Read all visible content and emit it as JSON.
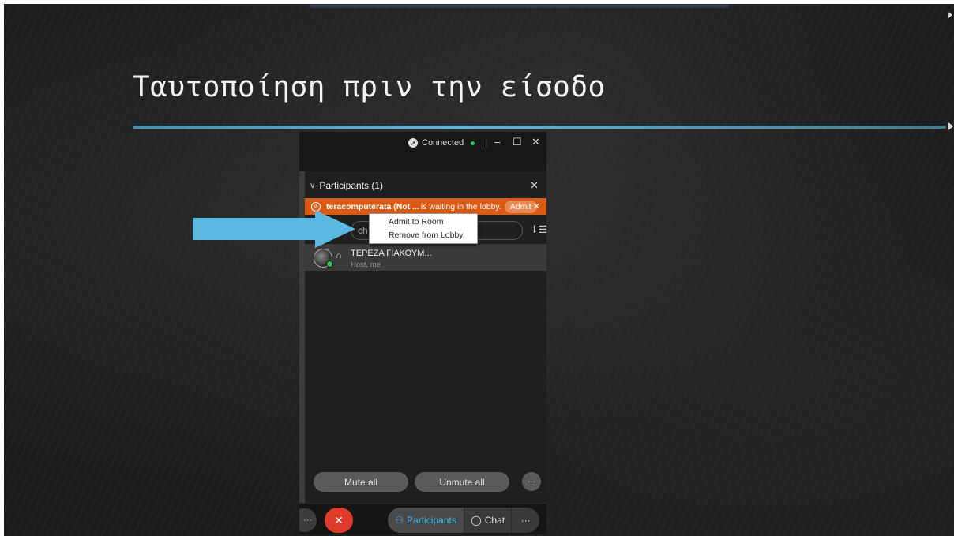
{
  "slide": {
    "title": "Ταυτοποίηση πριν την είσοδο"
  },
  "window": {
    "status": "Connected",
    "status_color": "#2fc15b",
    "separator": "|",
    "minimize": "–",
    "maximize": "☐",
    "close": "✕"
  },
  "panel": {
    "title": "Participants (1)",
    "close": "✕",
    "lobby": {
      "name": "teracomputerata (Not ...",
      "message": "is waiting in the lobby.",
      "admit_label": "Admit",
      "dismiss": "✕",
      "banner_color": "#d85a14"
    },
    "search_placeholder": "ch",
    "participants": [
      {
        "name": "ΤΕΡΕΖΑ ΓΙΑΚΟΥΜ...",
        "role": "Host, me"
      }
    ],
    "mute_all": "Mute all",
    "unmute_all": "Unmute all",
    "more": "···"
  },
  "context_menu": {
    "items": [
      "Admit to Room",
      "Remove from Lobby"
    ]
  },
  "bottom_bar": {
    "more_left": "···",
    "participants_label": "Participants",
    "chat_label": "Chat",
    "more_right": "···",
    "accent_color": "#3fb5e6",
    "end_color": "#e03a2a"
  },
  "icons": [
    "connection-icon",
    "chevron-down-icon",
    "lobby-person-icon",
    "sort-icon",
    "headset-icon",
    "end-call-icon",
    "participants-icon",
    "chat-icon",
    "arrow-pointer"
  ]
}
